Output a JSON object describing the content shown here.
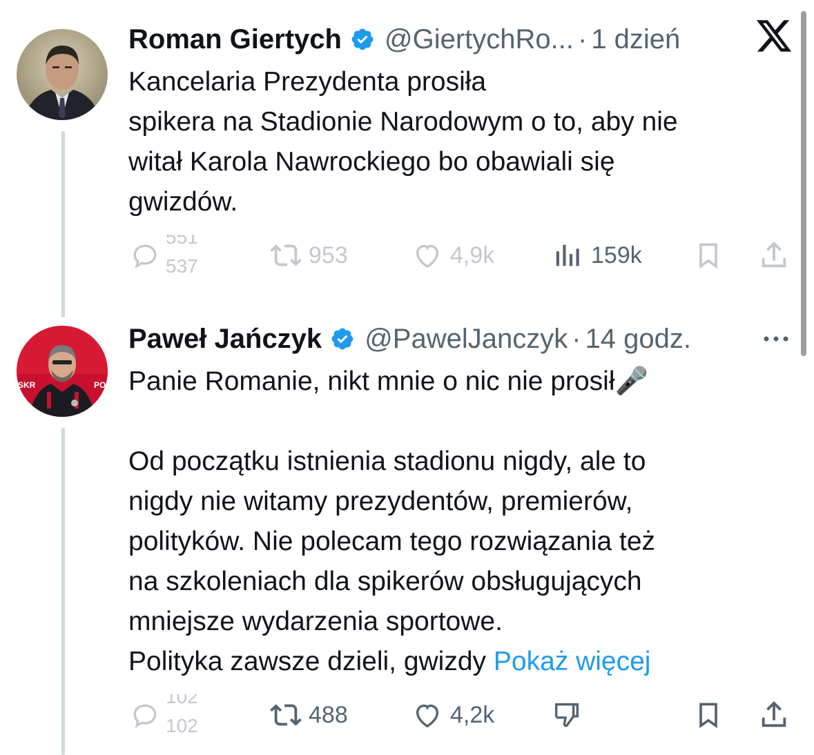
{
  "tweet1": {
    "name": "Roman Giertych",
    "handle": "@GiertychRo...",
    "separator": "·",
    "time": "1 dzień",
    "text": "Kancelaria Prezydenta prosiła\nspikera na Stadionie Narodowym o to, aby nie\nwitał Karola Nawrockiego bo obawiali się\ngwizdów.",
    "reply_count_prev": "551",
    "reply_count": "537",
    "retweets": "953",
    "likes": "4,9k",
    "views": "159k"
  },
  "tweet2": {
    "name": "Paweł Jańczyk",
    "handle": "@PawelJanczyk",
    "separator": "·",
    "time": "14 godz.",
    "text_line1": "Panie Romanie, nikt mnie o nic nie prosił🎤",
    "text_body": "Od początku istnienia stadionu nigdy, ale to\nnigdy nie witamy prezydentów, premierów,\npolityków. Nie polecam tego rozwiązania też\nna szkoleniach dla spikerów obsługujących\nmniejsze wydarzenia sportowe.",
    "text_last": "Polityka zawsze dzieli, gwizdy ",
    "show_more": "Pokaż więcej",
    "reply_count_prev": "102",
    "reply_count": "102",
    "retweets": "488",
    "likes": "4,2k"
  },
  "icons": {
    "verified_color": "#1d9bf0",
    "x_logo": "x-logo-icon",
    "more": "more-options-icon"
  },
  "colors": {
    "text": "#0f1419",
    "muted": "#536471",
    "link": "#1d9bf0",
    "thread_line": "#cfd9de"
  }
}
